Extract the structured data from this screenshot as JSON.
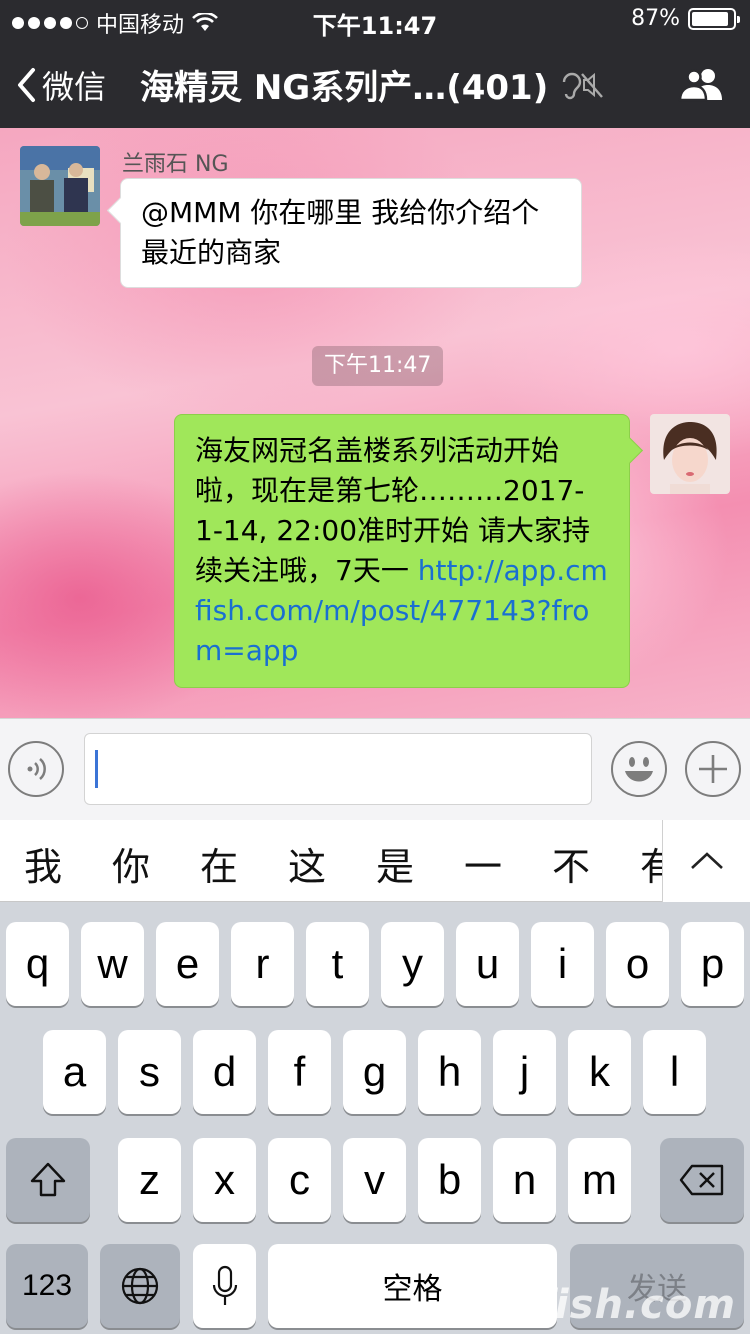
{
  "status_bar": {
    "carrier": "中国移动",
    "time": "下午11:47",
    "battery": "87%",
    "battery_level": 0.87
  },
  "nav": {
    "back_label": "微信",
    "title": "海精灵 NG系列产…(401)"
  },
  "chat": {
    "messages": [
      {
        "sender": "兰雨石 NG",
        "text": "@MMM 你在哪里 我给你介绍个最近的商家",
        "side": "left"
      },
      {
        "timestamp": "下午11:47"
      },
      {
        "text": "海友网冠名盖楼系列活动开始啦，现在是第七轮………2017-1-14, 22:00准时开始 请大家持续关注哦，7天一 ",
        "link": "http://app.cmfish.com/m/post/477143?from=app",
        "side": "right"
      }
    ]
  },
  "input": {
    "value": ""
  },
  "candidates": [
    "我",
    "你",
    "在",
    "这",
    "是",
    "一",
    "不",
    "有"
  ],
  "keyboard": {
    "row1": [
      "q",
      "w",
      "e",
      "r",
      "t",
      "y",
      "u",
      "i",
      "o",
      "p"
    ],
    "row2": [
      "a",
      "s",
      "d",
      "f",
      "g",
      "h",
      "j",
      "k",
      "l"
    ],
    "row3": [
      "z",
      "x",
      "c",
      "v",
      "b",
      "n",
      "m"
    ],
    "numbers_label": "123",
    "space_label": "空格",
    "send_label": "发送"
  },
  "watermark": "cmfish.com",
  "icons": [
    "wifi-icon",
    "chevron-left-icon",
    "ear-mute-icon",
    "group-icon",
    "voice-icon",
    "emoji-icon",
    "plus-icon",
    "chevron-up-icon",
    "shift-icon",
    "delete-icon",
    "globe-icon",
    "microphone-icon"
  ]
}
